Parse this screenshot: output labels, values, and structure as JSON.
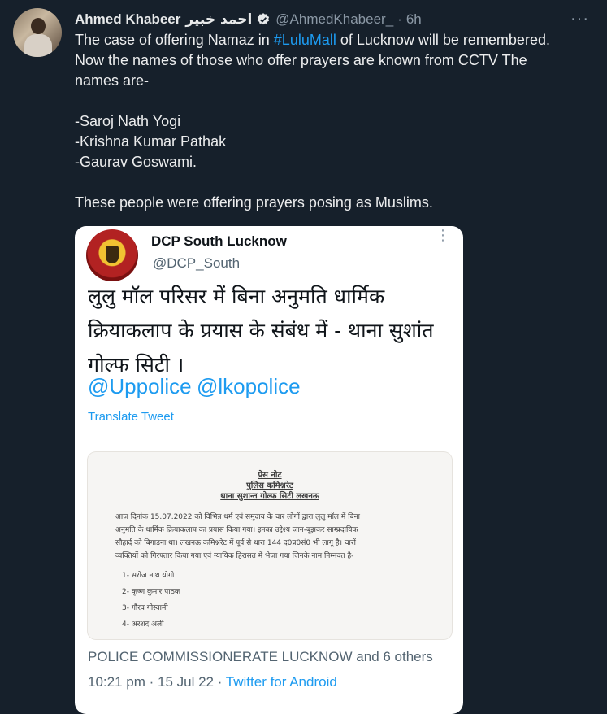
{
  "tweet": {
    "author_name": "Ahmed Khabeer",
    "author_name_arabic": "احمد خبیر",
    "handle": "@AhmedKhabeer_",
    "separator": "·",
    "time": "6h",
    "more": "···",
    "text": {
      "line1_pre": "The case of offering Namaz in ",
      "hashtag": "#LuluMall",
      "line1_post": " of Lucknow will be remembered.",
      "line2": "Now the names of those who offer prayers are known from CCTV The",
      "line3": "names are-",
      "name1": "-Saroj Nath Yogi",
      "name2": "-Krishna Kumar Pathak",
      "name3": "-Gaurav Goswami.",
      "closing": "These people were offering prayers posing as Muslims."
    }
  },
  "quoted": {
    "name": "DCP South Lucknow",
    "handle": "@DCP_South",
    "more": "⋮",
    "text_line1": "लुलु मॉल परिसर में बिना अनुमति धार्मिक",
    "text_line2": "क्रियाकलाप के प्रयास के संबंध में - थाना सुशांत",
    "text_line3": "गोल्फ सिटी ।",
    "mention1": "@Uppolice",
    "mention2": "@lkopolice",
    "translate": "Translate Tweet",
    "press": {
      "title1": "प्रेस नोट",
      "title2": "पुलिस कमिश्नरेट",
      "title3": "थाना सुशान्त गोल्फ सिटी लखनऊ",
      "para1": "आज दिनांक 15.07.2022 को विभिन्न धर्म एवं समुदाय के चार लोगों द्वारा लुलु मॉल में बिना",
      "para2": "अनुमति के धार्मिक क्रियाकलाप का प्रयास किया गया। इनका उद्देश्य जान-बूझकर साम्प्रदायिक",
      "para3": "सौहार्द को बिगाड़ना था। लखनऊ कमिश्नरेट में पूर्व से धारा 144 द0प्र0सं0 भी लागू है। चारों",
      "para4": "व्यक्तियों को गिरफ्तार किया गया एवं न्यायिक हिरासत में भेजा गया जिनके नाम निम्नवत है-",
      "item1": "1-  सरोज नाथ योगी",
      "item2": "2-  कृष्ण कुमार पाठक",
      "item3": "3-  गौरव गोस्वामी",
      "item4": "4-  अरशद अली"
    },
    "footer_likes": "POLICE COMMISSIONERATE LUCKNOW and 6 others",
    "footer_time": "10:21 pm · 15 Jul 22 · ",
    "footer_source": "Twitter for Android"
  }
}
